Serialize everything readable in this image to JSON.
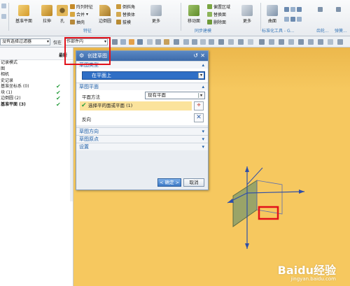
{
  "ribbon": {
    "groups": {
      "feature": {
        "label": "特征",
        "big_buttons": [
          "基准平面",
          "拉伸",
          "孔",
          "边倒圆",
          "更多"
        ],
        "small_buttons": [
          "阵列特征",
          "合并",
          "抽壳",
          "倒斜角",
          "拔模",
          "替换体"
        ]
      },
      "sync": {
        "label": "同步建模",
        "big_buttons": [
          "移动面",
          "更多"
        ],
        "small_buttons": [
          "偏置区域",
          "替换面",
          "删除面"
        ]
      },
      "standard": {
        "label": "标准化工具 - G...",
        "big_buttons": [
          "曲面"
        ]
      },
      "gear": {
        "label": "齿轮..."
      },
      "spring": {
        "label": "弹簧..."
      }
    }
  },
  "toolbar2": {
    "filter_label": "没有选择过滤器",
    "scope_label": "仅在",
    "scope_value": "作部件内"
  },
  "nav": {
    "header_right": "最新",
    "items": [
      {
        "label": "记录模式",
        "check": ""
      },
      {
        "label": "图",
        "check": ""
      },
      {
        "label": "相机",
        "check": ""
      },
      {
        "label": "史记录",
        "check": ""
      },
      {
        "label": "基准坐标系 (0)",
        "check": "✔"
      },
      {
        "label": "块 (1)",
        "check": "✔"
      },
      {
        "label": "边倒圆 (2)",
        "check": "✔"
      },
      {
        "label": "基准平面 (3)",
        "check": "✔",
        "bold": true
      }
    ]
  },
  "dialog": {
    "title": "创建草图",
    "sections": {
      "type": {
        "label": "草图类型",
        "value": "在平面上"
      },
      "plane": {
        "label": "草图平面",
        "method_label": "平面方法",
        "method_value": "现有平面",
        "select_label": "选择平的面或平面 (1)",
        "reverse_label": "反向"
      },
      "direction": {
        "label": "草图方向"
      },
      "origin": {
        "label": "草图原点"
      },
      "settings": {
        "label": "设置"
      }
    },
    "ok_label": "< 确定 >",
    "cancel_label": "取消"
  },
  "watermark": {
    "brand": "Baidu经验",
    "domain": "jingyan.baidu.com"
  },
  "colors": {
    "viewport": "#f6c85f",
    "dialog_title": "#3c6aa9",
    "highlight_row": "#fbe39c",
    "red_annotation": "#e2121b",
    "datum_plane": "#8a9e6a"
  }
}
